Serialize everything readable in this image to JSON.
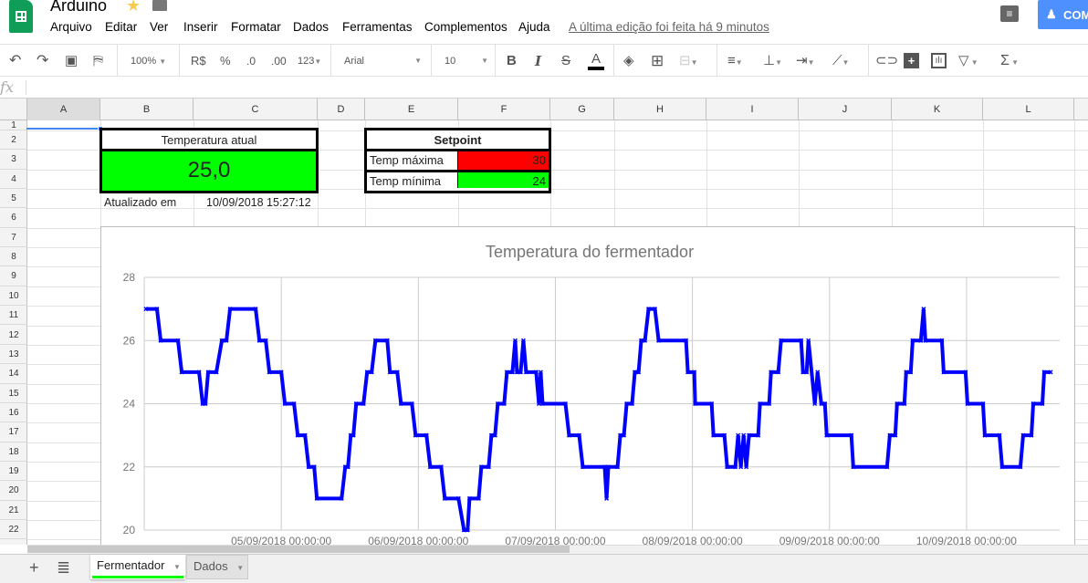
{
  "app": {
    "title": "Arduino",
    "last_edit": "A última edição foi feita há 9 minutos",
    "share_label": "COM"
  },
  "menu": [
    "Arquivo",
    "Editar",
    "Ver",
    "Inserir",
    "Formatar",
    "Dados",
    "Ferramentas",
    "Complementos",
    "Ajuda"
  ],
  "toolbar": {
    "zoom": "100%",
    "currency": "R$",
    "percent": "%",
    "dec_less": ".0",
    "dec_more": ".00",
    "more_formats": "123",
    "font": "Arial",
    "font_size": "10",
    "bold": "B",
    "italic": "I",
    "strike": "S",
    "text_color": "A",
    "text_color_hex": "#000000"
  },
  "formula_bar": {
    "label": "fx",
    "value": ""
  },
  "columns": [
    "A",
    "B",
    "C",
    "D",
    "E",
    "F",
    "G",
    "H",
    "I",
    "J",
    "K",
    "L"
  ],
  "rows": [
    "1",
    "2",
    "3",
    "4",
    "5",
    "6",
    "7",
    "8",
    "9",
    "10",
    "11",
    "12",
    "13",
    "14",
    "15",
    "16",
    "17",
    "18",
    "19",
    "20",
    "21",
    "22"
  ],
  "temperature": {
    "header": "Temperatura atual",
    "value": "25,0",
    "updated_label": "Atualizado em",
    "updated_value": "10/09/2018 15:27:12",
    "color": "#00ff00"
  },
  "setpoint": {
    "header": "Setpoint",
    "max_label": "Temp máxima",
    "max_value": "30",
    "max_color": "#ff0000",
    "min_label": "Temp mínima",
    "min_value": "24",
    "min_color": "#00ff00"
  },
  "sheets": [
    {
      "label": "Fermentador",
      "active": true
    },
    {
      "label": "Dados",
      "active": false
    }
  ],
  "chart_data": {
    "type": "line",
    "title": "Temperatura do fermentador",
    "color": "#0000ff",
    "marker": "x",
    "grid": true,
    "ylim": [
      20,
      28
    ],
    "yticks": [
      "28",
      "26",
      "24",
      "22",
      "20"
    ],
    "xlim": [
      "2018-09-04 00:00",
      "2018-09-10 16:19"
    ],
    "xticks": [
      "05/09/2018 00:00:00",
      "06/09/2018 00:00:00",
      "07/09/2018 00:00:00",
      "08/09/2018 00:00:00",
      "09/09/2018 00:00:00",
      "10/09/2018 00:00:00"
    ],
    "x": [
      "2018-09-04 00:19",
      "2018-09-04 02:14",
      "2018-09-04 02:53",
      "2018-09-04 05:55",
      "2018-09-04 06:34",
      "2018-09-04 09:36",
      "2018-09-04 10:14",
      "2018-09-04 10:43",
      "2018-09-04 11:12",
      "2018-09-04 12:38",
      "2018-09-04 13:36",
      "2018-09-04 14:24",
      "2018-09-04 15:02",
      "2018-09-04 19:31",
      "2018-09-04 20:10",
      "2018-09-04 21:17",
      "2018-09-04 21:55",
      "2018-09-05 00:00",
      "2018-09-05 00:38",
      "2018-09-05 02:14",
      "2018-09-05 02:53",
      "2018-09-05 04:10",
      "2018-09-05 04:48",
      "2018-09-05 05:46",
      "2018-09-05 06:14",
      "2018-09-05 10:34",
      "2018-09-05 11:12",
      "2018-09-05 11:41",
      "2018-09-05 12:10",
      "2018-09-05 12:38",
      "2018-09-05 13:07",
      "2018-09-05 14:24",
      "2018-09-05 15:02",
      "2018-09-05 15:50",
      "2018-09-05 16:29",
      "2018-09-05 18:34",
      "2018-09-05 19:02",
      "2018-09-05 20:19",
      "2018-09-05 20:58",
      "2018-09-05 22:53",
      "2018-09-05 23:31",
      "2018-09-06 01:26",
      "2018-09-06 02:05",
      "2018-09-06 04:00",
      "2018-09-06 04:38",
      "2018-09-06 07:02",
      "2018-09-06 08:00",
      "2018-09-06 08:38",
      "2018-09-06 08:58",
      "2018-09-06 10:34",
      "2018-09-06 11:02",
      "2018-09-06 12:19",
      "2018-09-06 12:48",
      "2018-09-06 13:26",
      "2018-09-06 13:55",
      "2018-09-06 15:02",
      "2018-09-06 15:31",
      "2018-09-06 16:29",
      "2018-09-06 16:58",
      "2018-09-06 17:17",
      "2018-09-06 17:55",
      "2018-09-06 18:24",
      "2018-09-06 18:53",
      "2018-09-06 20:38",
      "2018-09-06 21:07",
      "2018-09-06 21:26",
      "2018-09-06 21:46",
      "2018-09-07 01:46",
      "2018-09-07 02:24",
      "2018-09-07 04:10",
      "2018-09-07 04:48",
      "2018-09-07 08:38",
      "2018-09-07 08:58",
      "2018-09-07 09:17",
      "2018-09-07 10:53",
      "2018-09-07 11:22",
      "2018-09-07 12:00",
      "2018-09-07 12:29",
      "2018-09-07 13:26",
      "2018-09-07 13:55",
      "2018-09-07 14:34",
      "2018-09-07 15:02",
      "2018-09-07 15:41",
      "2018-09-07 16:19",
      "2018-09-07 17:26",
      "2018-09-07 18:05",
      "2018-09-07 22:53",
      "2018-09-07 23:12",
      "2018-09-08 00:19",
      "2018-09-08 00:29",
      "2018-09-08 03:22",
      "2018-09-08 03:41",
      "2018-09-08 05:36",
      "2018-09-08 06:05",
      "2018-09-08 07:31",
      "2018-09-08 08:00",
      "2018-09-08 08:29",
      "2018-09-08 08:58",
      "2018-09-08 09:26",
      "2018-09-08 09:55",
      "2018-09-08 11:31",
      "2018-09-08 11:50",
      "2018-09-08 13:26",
      "2018-09-08 13:46",
      "2018-09-08 15:02",
      "2018-09-08 15:31",
      "2018-09-08 19:02",
      "2018-09-08 19:22",
      "2018-09-08 20:00",
      "2018-09-08 20:19",
      "2018-09-08 21:26",
      "2018-09-08 21:55",
      "2018-09-08 22:34",
      "2018-09-08 23:12",
      "2018-09-08 23:31",
      "2018-09-09 03:50",
      "2018-09-09 04:10",
      "2018-09-09 10:05",
      "2018-09-09 10:34",
      "2018-09-09 11:31",
      "2018-09-09 11:50",
      "2018-09-09 13:07",
      "2018-09-09 13:26",
      "2018-09-09 14:14",
      "2018-09-09 14:34",
      "2018-09-09 16:00",
      "2018-09-09 16:29",
      "2018-09-09 16:48",
      "2018-09-09 19:41",
      "2018-09-09 20:00",
      "2018-09-09 23:50",
      "2018-09-10 00:10",
      "2018-09-10 02:53",
      "2018-09-10 03:12",
      "2018-09-10 05:46",
      "2018-09-10 06:14",
      "2018-09-10 09:26",
      "2018-09-10 09:55",
      "2018-09-10 11:22",
      "2018-09-10 11:41",
      "2018-09-10 13:17",
      "2018-09-10 13:36",
      "2018-09-10 14:43"
    ],
    "y": [
      27,
      27,
      26,
      26,
      25,
      25,
      24,
      24,
      25,
      25,
      26,
      26,
      27,
      27,
      26,
      26,
      25,
      25,
      24,
      24,
      23,
      23,
      22,
      22,
      21,
      21,
      22,
      22,
      23,
      23,
      24,
      24,
      25,
      25,
      26,
      26,
      25,
      25,
      24,
      24,
      23,
      23,
      22,
      22,
      21,
      21,
      20,
      20,
      21,
      21,
      22,
      22,
      23,
      23,
      24,
      24,
      25,
      25,
      26,
      25,
      25,
      26,
      25,
      25,
      24,
      25,
      24,
      24,
      23,
      23,
      22,
      22,
      21,
      22,
      22,
      23,
      23,
      24,
      24,
      25,
      25,
      26,
      26,
      27,
      27,
      26,
      26,
      25,
      25,
      24,
      24,
      23,
      23,
      22,
      22,
      23,
      22,
      23,
      22,
      23,
      23,
      24,
      24,
      25,
      25,
      26,
      26,
      25,
      25,
      26,
      24,
      25,
      24,
      24,
      23,
      23,
      22,
      22,
      23,
      23,
      24,
      24,
      25,
      25,
      26,
      26,
      27,
      26,
      26,
      25,
      25,
      24,
      24,
      23,
      23,
      22,
      22,
      23,
      23,
      24,
      24,
      25,
      25
    ]
  }
}
